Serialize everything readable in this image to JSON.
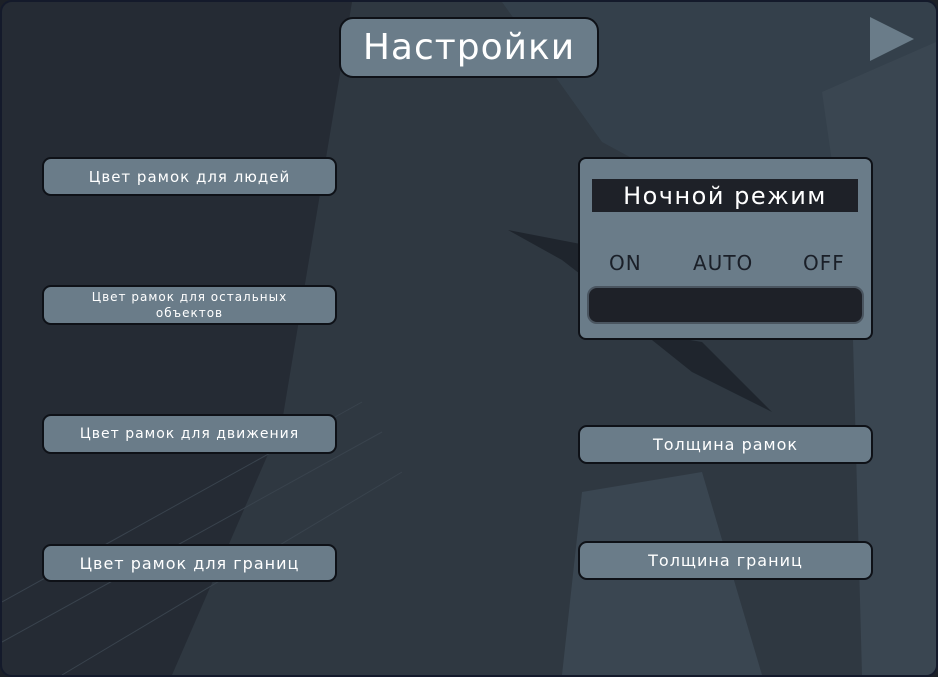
{
  "header": {
    "title": "Настройки"
  },
  "nav": {
    "next_icon": "play-arrow-icon"
  },
  "left_buttons": [
    {
      "label": "Цвет рамок для людей"
    },
    {
      "label": "Цвет рамок для остальных объектов"
    },
    {
      "label": "Цвет рамок для движения"
    },
    {
      "label": "Цвет рамок для границ"
    }
  ],
  "night_mode": {
    "label": "Ночной режим",
    "options": [
      "ON",
      "AUTO",
      "OFF"
    ]
  },
  "right_buttons": [
    {
      "label": "Толщина рамок"
    },
    {
      "label": "Толщина границ"
    }
  ],
  "colors": {
    "background": "#252b34",
    "button": "#6a7c89",
    "border": "#0e1117",
    "dark_panel": "#1e2128"
  }
}
